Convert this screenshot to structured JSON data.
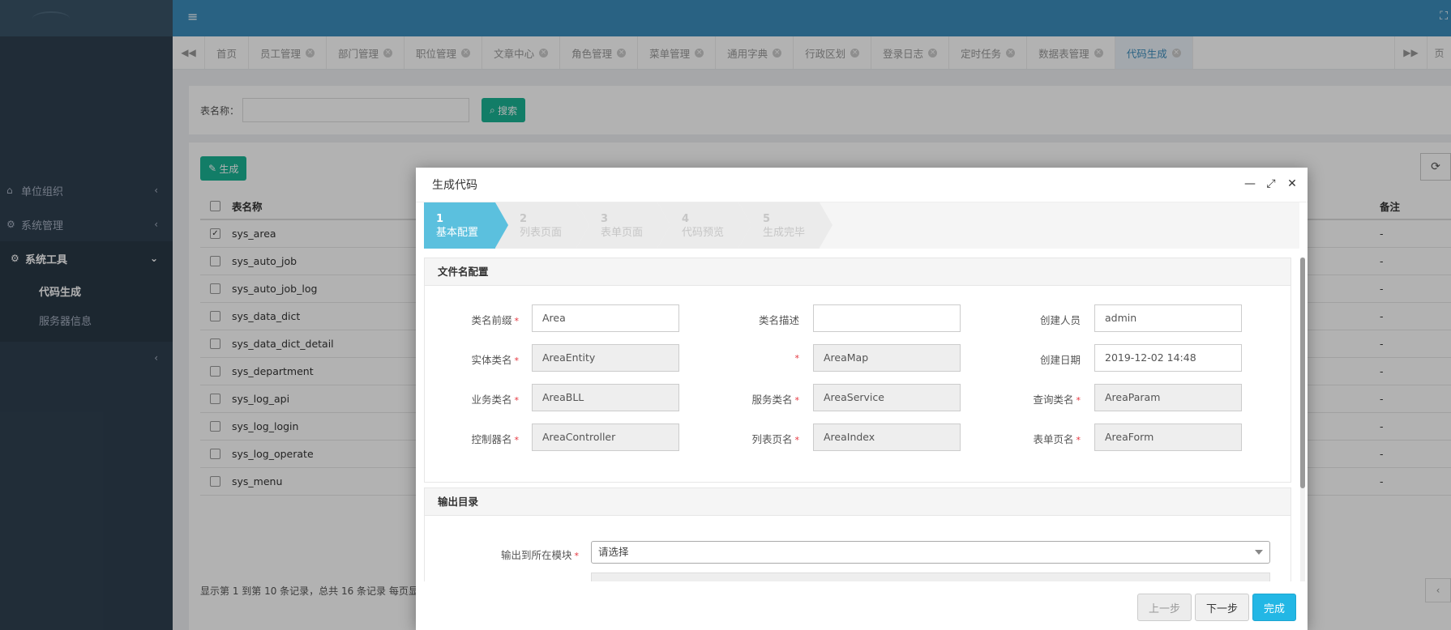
{
  "topbar": {
    "menu_icon": "menu-icon",
    "fullscreen_icon": "fullscreen-icon"
  },
  "sidebar": {
    "items": [
      {
        "label": "单位组织",
        "icon": "home-icon"
      },
      {
        "label": "系统管理",
        "icon": "gear-icon"
      },
      {
        "label": "系统工具",
        "icon": "gears-icon"
      }
    ],
    "subitems": [
      "代码生成",
      "服务器信息"
    ]
  },
  "tabs": [
    "首页",
    "员工管理",
    "部门管理",
    "职位管理",
    "文章中心",
    "角色管理",
    "菜单管理",
    "通用字典",
    "行政区划",
    "登录日志",
    "定时任务",
    "数据表管理",
    "代码生成"
  ],
  "tab_edge": "页",
  "search": {
    "label": "表名称：",
    "button": "搜索"
  },
  "toolbar": {
    "generate": "生成"
  },
  "table": {
    "headers": [
      "表名称",
      "备注"
    ],
    "rows": [
      {
        "name": "sys_area",
        "note": "-",
        "checked": true
      },
      {
        "name": "sys_auto_job",
        "note": "-"
      },
      {
        "name": "sys_auto_job_log",
        "note": "-"
      },
      {
        "name": "sys_data_dict",
        "note": "-"
      },
      {
        "name": "sys_data_dict_detail",
        "note": "-"
      },
      {
        "name": "sys_department",
        "note": "-"
      },
      {
        "name": "sys_log_api",
        "note": "-"
      },
      {
        "name": "sys_log_login",
        "note": "-"
      },
      {
        "name": "sys_log_operate",
        "note": "-"
      },
      {
        "name": "sys_menu",
        "note": "-"
      }
    ],
    "pager_text": "显示第 1 到第 10 条记录，总共 16 条记录 每页显",
    "pager_prev": "‹"
  },
  "modal": {
    "title": "生成代码",
    "steps": [
      {
        "num": "1",
        "label": "基本配置"
      },
      {
        "num": "2",
        "label": "列表页面"
      },
      {
        "num": "3",
        "label": "表单页面"
      },
      {
        "num": "4",
        "label": "代码预览"
      },
      {
        "num": "5",
        "label": "生成完毕"
      }
    ],
    "section1": "文件名配置",
    "fields": {
      "class_prefix": {
        "label": "类名前缀",
        "value": "Area"
      },
      "class_desc": {
        "label": "类名描述",
        "value": ""
      },
      "creator": {
        "label": "创建人员",
        "value": "admin"
      },
      "entity": {
        "label": "实体类名",
        "value": "AreaEntity"
      },
      "map": {
        "label": "",
        "value": "AreaMap"
      },
      "create_date": {
        "label": "创建日期",
        "value": "2019-12-02 14:48"
      },
      "bll": {
        "label": "业务类名",
        "value": "AreaBLL"
      },
      "service": {
        "label": "服务类名",
        "value": "AreaService"
      },
      "param": {
        "label": "查询类名",
        "value": "AreaParam"
      },
      "controller": {
        "label": "控制器名",
        "value": "AreaController"
      },
      "index_page": {
        "label": "列表页名",
        "value": "AreaIndex"
      },
      "form_page": {
        "label": "表单页名",
        "value": "AreaForm"
      }
    },
    "section2": "输出目录",
    "output_module": {
      "label": "输出到所在模块",
      "value": "请选择"
    },
    "buttons": {
      "prev": "上一步",
      "next": "下一步",
      "finish": "完成"
    }
  },
  "colors": {
    "sidebar": "#2f4050",
    "topbar": "#3c8dbc",
    "accent": "#5bc0de",
    "green": "#1ab394",
    "primary": "#23b7e5",
    "required": "#e5343d"
  }
}
